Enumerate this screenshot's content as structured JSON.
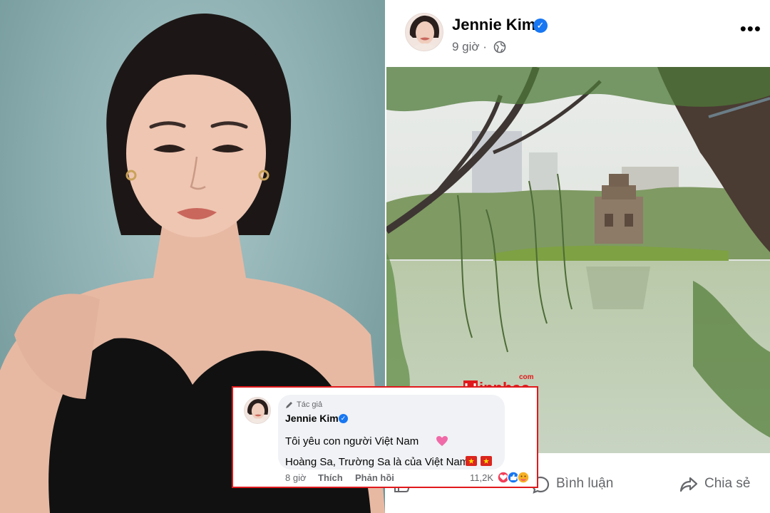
{
  "post": {
    "author": "Jennie Kim",
    "time": "9 giờ",
    "separator": "·",
    "more": "•••",
    "verified_badge": "check-icon"
  },
  "actions": {
    "like": "Thích",
    "comment": "Bình luận",
    "share": "Chia sẻ"
  },
  "comment": {
    "author_tag": "Tác giả",
    "author": "Jennie Kim",
    "line1": "Tôi yêu con người Việt Nam",
    "line2": "Hoàng Sa, Trường Sa là của Việt Nam",
    "time": "8 giờ",
    "like_label": "Thích",
    "reply_label": "Phản hồi",
    "reaction_count": "11,2K"
  },
  "watermark": {
    "domain": "com",
    "brand": "innhac"
  },
  "colors": {
    "facebook_blue": "#1877f2",
    "meta_gray": "#65676b",
    "highlight_red": "#e0191c",
    "bubble_bg": "#f0f2f5"
  }
}
